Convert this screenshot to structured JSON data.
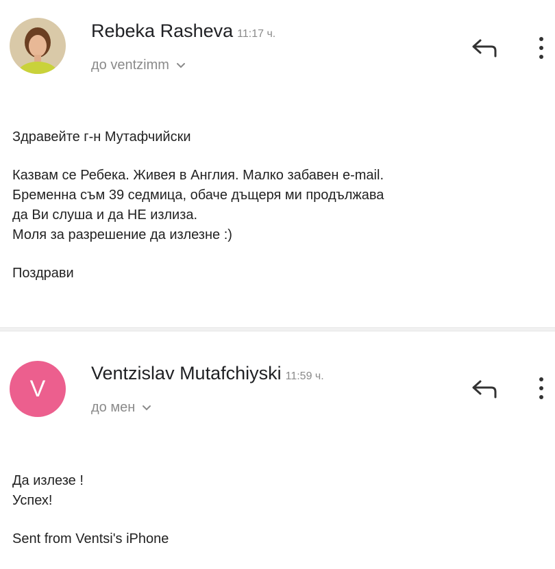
{
  "messages": [
    {
      "sender": "Rebeka Rasheva",
      "time": "11:17 ч.",
      "recipient": "до ventzimm",
      "avatar": {
        "type": "photo",
        "colors": {
          "background": "#d9c9a8",
          "hair": "#6b3f22",
          "face": "#e8b896",
          "shirt": "#c9d23a"
        }
      },
      "body": {
        "greeting": "Здравейте г-н Мутафчийски",
        "lines": [
          "Казвам се Ребека. Живея в Англия. Малко забавен e-mail.",
          "Бременна съм 39 седмица, обаче дъщеря ми продължава",
          "да Ви слуша и да НЕ излиза.",
          "Моля за разрешение да излезне :)"
        ],
        "closing": "Поздрави"
      }
    },
    {
      "sender": "Ventzislav Mutafchiyski",
      "time": "11:59 ч.",
      "recipient": "до мен",
      "avatar": {
        "type": "letter",
        "letter": "V",
        "color": "#ec5f8e"
      },
      "body": {
        "lines": [
          "Да излезе !",
          "Успех!"
        ],
        "signature": "Sent from Ventsi's iPhone"
      }
    }
  ],
  "icons": {
    "reply": "reply-arrow-icon",
    "more": "vertical-dots-icon",
    "expand": "chevron-down-icon"
  },
  "colors": {
    "text": "#222222",
    "muted": "#8a8a8a",
    "divider": "#f1f1f1"
  }
}
